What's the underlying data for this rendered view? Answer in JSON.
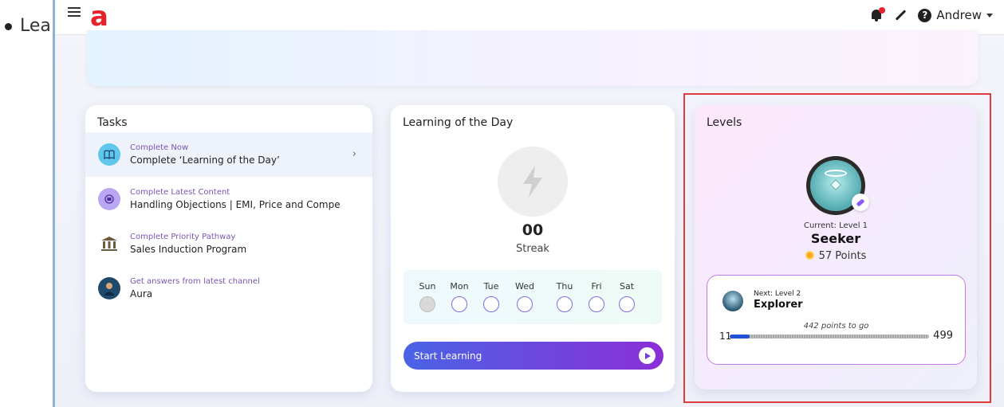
{
  "outer": {
    "bullet_text": "Lea"
  },
  "header": {
    "logo": "a",
    "user_name": "Andrew",
    "help_glyph": "?"
  },
  "icons": {
    "menu": "hamburger-icon",
    "notifications": "bell-icon",
    "edit": "pen-icon",
    "help": "help-circle-icon",
    "dropdown": "caret-down-icon"
  },
  "colors": {
    "brand": "#e5232d",
    "accent_purple": "#7a55b3",
    "button_start": "#4a63e6",
    "button_end": "#8b2fd7",
    "highlight": "#e03c3c",
    "progress": "#2352d6",
    "coin": "#f6a81a"
  },
  "tasks": {
    "title": "Tasks",
    "items": [
      {
        "sub": "Complete Now",
        "main": "Complete ‘Learning of the Day’",
        "icon": "book-icon"
      },
      {
        "sub": "Complete Latest Content",
        "main": "Handling Objections | EMI, Price and Compe...",
        "icon": "content-icon"
      },
      {
        "sub": "Complete Priority Pathway",
        "main": "Sales Induction Program",
        "icon": "pillar-icon"
      },
      {
        "sub": "Get answers from latest channel",
        "main": "Aura",
        "icon": "avatar-icon"
      }
    ],
    "chevron": "›"
  },
  "lotd": {
    "title": "Learning of the Day",
    "streak_value": "00",
    "streak_label": "Streak",
    "days": [
      "Sun",
      "Mon",
      "Tue",
      "Wed",
      "Thu",
      "Fri",
      "Sat"
    ],
    "start_label": "Start Learning"
  },
  "levels": {
    "title": "Levels",
    "current_label": "Current: Level 1",
    "current_name": "Seeker",
    "points": "57 Points",
    "next_label": "Next: Level 2",
    "next_name": "Explorer",
    "to_go": "442 points to go",
    "bar_min": "11",
    "bar_max": "499",
    "progress_fraction": 0.1
  }
}
